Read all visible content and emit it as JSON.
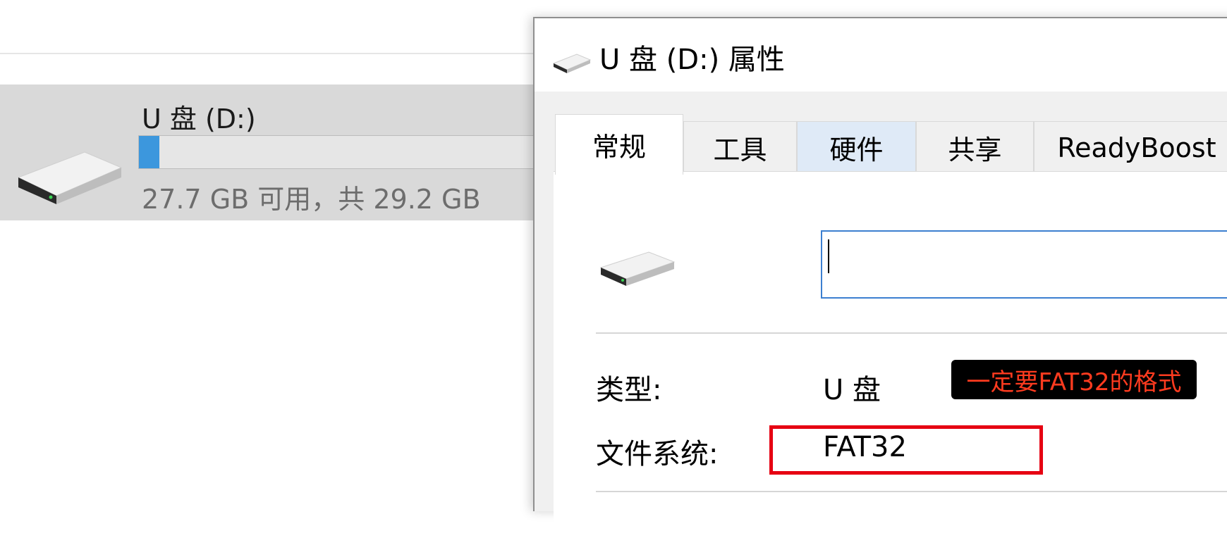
{
  "explorer": {
    "drive_name": "U 盘 (D:)",
    "space_text": "27.7 GB 可用，共 29.2 GB",
    "usage_free_gb": 27.7,
    "usage_total_gb": 29.2,
    "usage_fraction": 0.05,
    "drive_icon": "usb-drive-icon"
  },
  "dialog": {
    "title": "U 盘 (D:) 属性",
    "title_icon": "usb-drive-icon",
    "tabs": [
      {
        "label": "常规"
      },
      {
        "label": "工具"
      },
      {
        "label": "硬件"
      },
      {
        "label": "共享"
      },
      {
        "label": "ReadyBoost"
      }
    ],
    "volume_label_value": "",
    "type_label": "类型:",
    "type_value": "U 盘",
    "filesystem_label": "文件系统:",
    "filesystem_value": "FAT32",
    "annotation_text": "一定要FAT32的格式"
  },
  "colors": {
    "usage_fill": "#3c97dd",
    "annotation_text": "#ff3b1f",
    "highlight_border": "#e60012",
    "input_focus": "#3c7fd0"
  }
}
